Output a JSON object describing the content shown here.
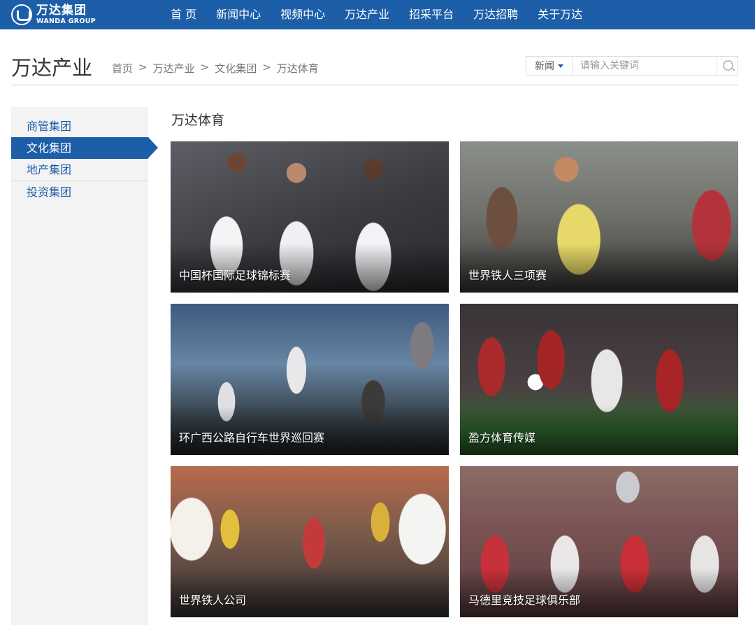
{
  "header": {
    "logo_cn": "万达集团",
    "logo_en": "WANDA GROUP",
    "brand_color": "#1c5ea8",
    "nav": [
      "首 页",
      "新闻中心",
      "视频中心",
      "万达产业",
      "招采平台",
      "万达招聘",
      "关于万达"
    ]
  },
  "page": {
    "title": "万达产业",
    "breadcrumb": [
      "首页",
      "万达产业",
      "文化集团",
      "万达体育"
    ],
    "breadcrumb_sep": ">"
  },
  "search": {
    "type": "新闻",
    "placeholder": "请输入关键词",
    "button_icon": "search-icon"
  },
  "sidebar": {
    "items": [
      {
        "label": "商管集团",
        "active": false
      },
      {
        "label": "文化集团",
        "active": true
      },
      {
        "label": "地产集团",
        "active": false
      },
      {
        "label": "投资集团",
        "active": false
      }
    ]
  },
  "main": {
    "section_title": "万达体育",
    "cards": [
      {
        "label": "中国杯国际足球锦标赛"
      },
      {
        "label": "世界铁人三项赛"
      },
      {
        "label": "环广西公路自行车世界巡回赛"
      },
      {
        "label": "盈方体育传媒"
      },
      {
        "label": "世界铁人公司"
      },
      {
        "label": "马德里竞技足球俱乐部"
      }
    ]
  }
}
